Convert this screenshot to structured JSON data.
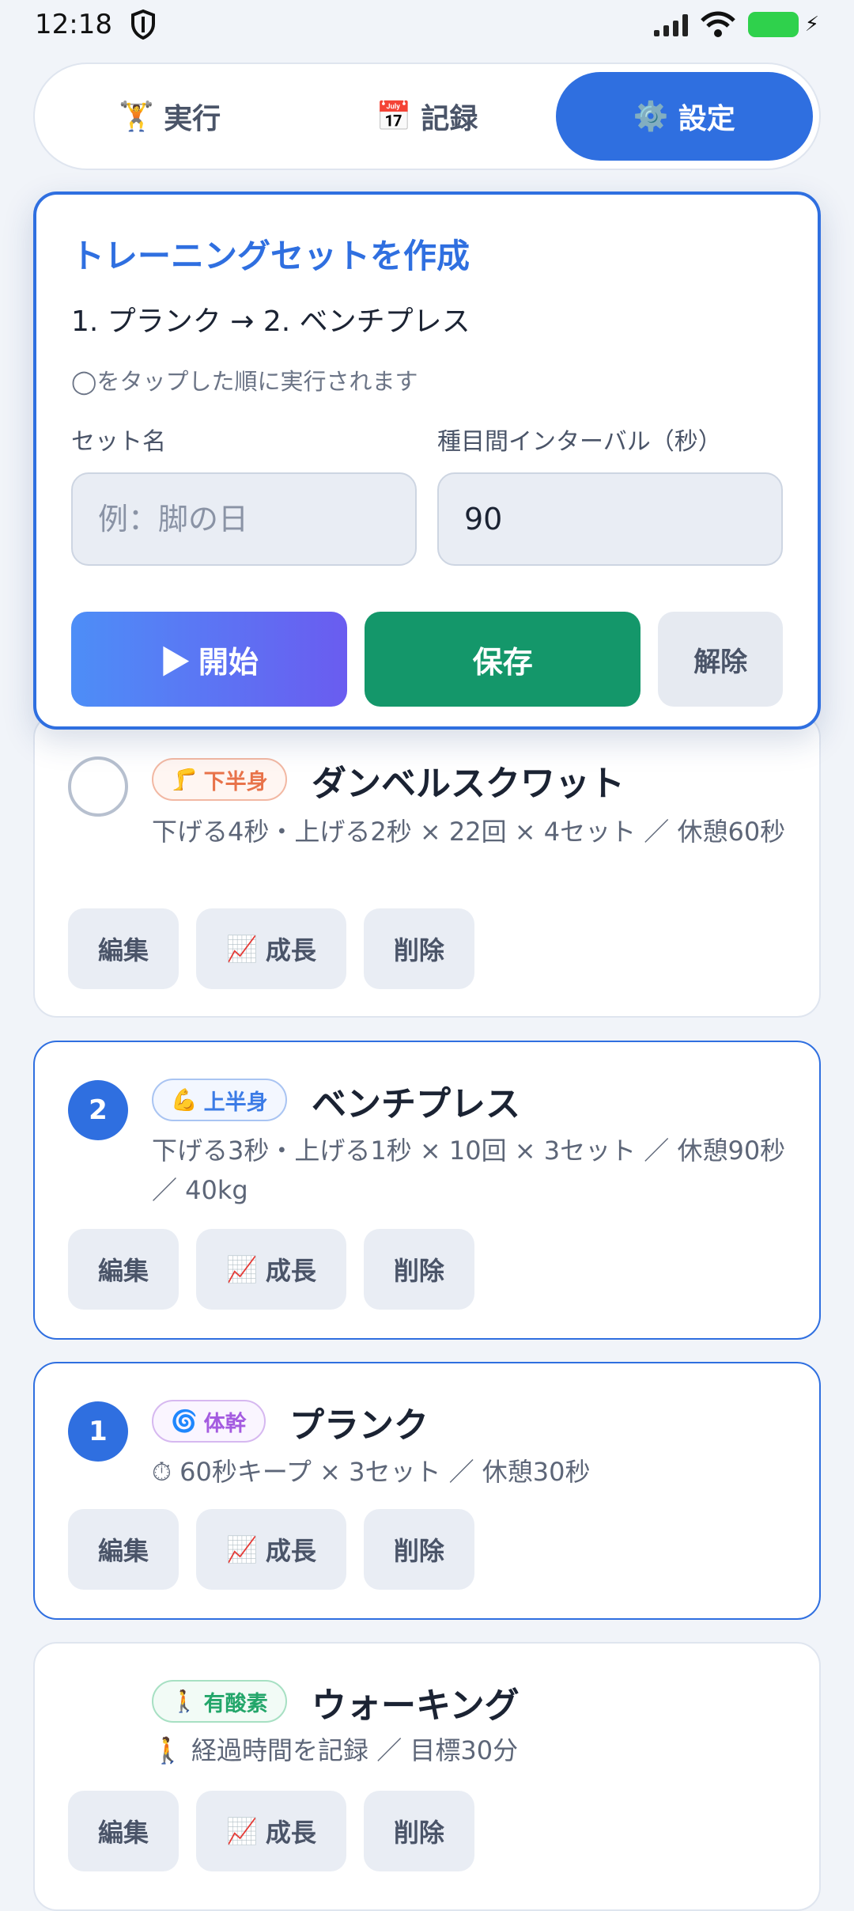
{
  "status": {
    "time": "12:18"
  },
  "tabs": [
    {
      "icon": "🏋️",
      "label": "実行"
    },
    {
      "icon": "📅",
      "label": "記録"
    },
    {
      "icon": "⚙️",
      "label": "設定"
    }
  ],
  "creator": {
    "title": "トレーニングセットを作成",
    "order": "1. プランク → 2. ベンチプレス",
    "hint": "◯をタップした順に実行されます",
    "set_name_label": "セット名",
    "set_name_placeholder": "例：脚の日",
    "interval_label": "種目間インターバル（秒）",
    "interval_value": "90",
    "start_label": "▶ 開始",
    "save_label": "保存",
    "clear_label": "解除"
  },
  "actions": {
    "edit": "編集",
    "growth_icon": "📈",
    "growth": "成長",
    "delete": "削除"
  },
  "exercises": [
    {
      "order": "",
      "category_icon": "🦵",
      "category": "下半身",
      "name": "ダンベルスクワット",
      "desc": "下げる4秒・上げる2秒 × 22回 × 4セット ／ 休憩60秒",
      "colors": {
        "fg": "#e8734a",
        "border": "#f2b8a3",
        "bg": "#fff6f2"
      }
    },
    {
      "order": "2",
      "category_icon": "💪",
      "category": "上半身",
      "name": "ベンチプレス",
      "desc": "下げる3秒・上げる1秒 × 10回 × 3セット ／ 休憩90秒 ／ 40kg",
      "colors": {
        "fg": "#3b7be6",
        "border": "#a9c4f2",
        "bg": "#f3f7ff"
      }
    },
    {
      "order": "1",
      "category_icon": "🌀",
      "category": "体幹",
      "name": "プランク",
      "desc": "⏱ 60秒キープ × 3セット ／ 休憩30秒",
      "colors": {
        "fg": "#a45be0",
        "border": "#d6b8f0",
        "bg": "#faf5ff"
      }
    },
    {
      "order": "",
      "category_icon": "🚶",
      "category": "有酸素",
      "name": "ウォーキング",
      "desc": "🚶 経過時間を記録 ／ 目標30分",
      "colors": {
        "fg": "#23a66a",
        "border": "#a7e0c3",
        "bg": "#f2fbf6"
      }
    }
  ]
}
